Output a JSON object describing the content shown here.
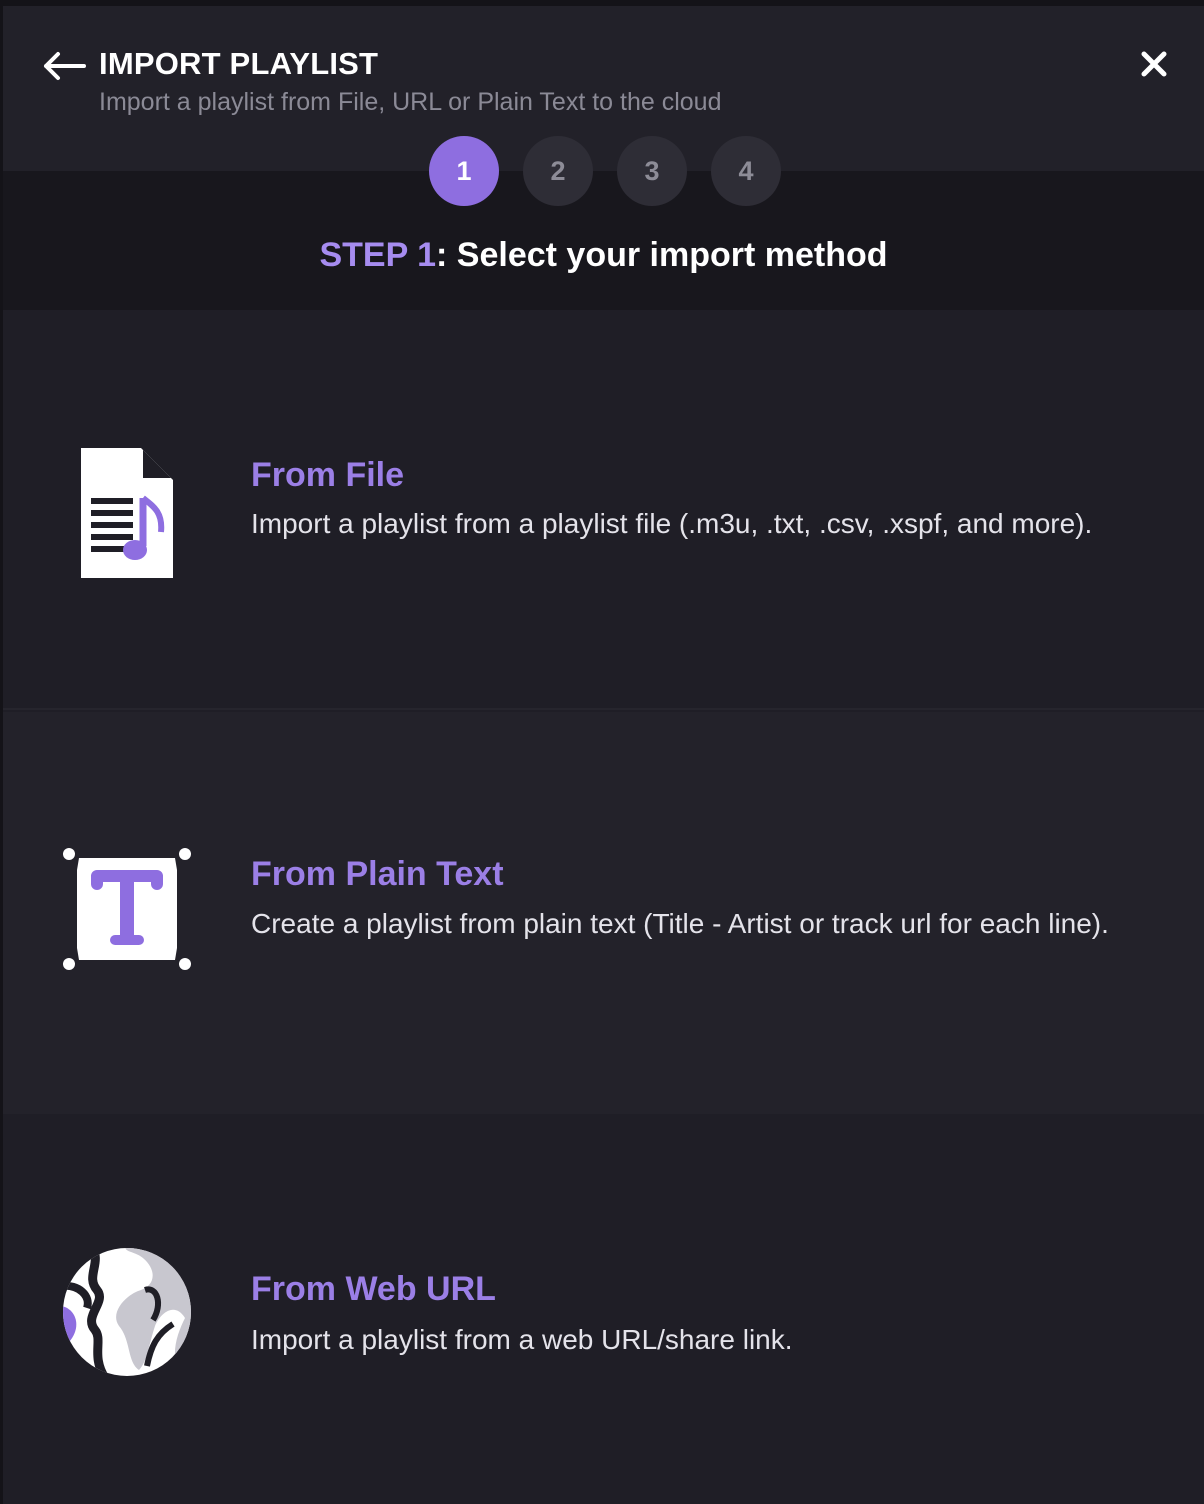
{
  "header": {
    "title": "IMPORT PLAYLIST",
    "subtitle": "Import a playlist from File, URL or Plain Text to the cloud",
    "back_icon": "arrow-left-icon",
    "close_icon": "close-icon"
  },
  "stepper": {
    "steps": [
      "1",
      "2",
      "3",
      "4"
    ],
    "active_step": 1
  },
  "step_heading": {
    "label": "STEP 1",
    "text": ": Select your import method"
  },
  "options": [
    {
      "icon": "music-file-icon",
      "title": "From File",
      "description": "Import a playlist from a playlist file (.m3u, .txt, .csv, .xspf, and more)."
    },
    {
      "icon": "text-frame-icon",
      "title": "From Plain Text",
      "description": "Create a playlist from plain text (Title - Artist or track url for each line)."
    },
    {
      "icon": "globe-icon",
      "title": "From Web URL",
      "description": "Import a playlist from a web URL/share link."
    }
  ],
  "colors": {
    "accent": "#8e6ee0",
    "accent_text": "#9b7fe6",
    "background": "#1f1e26"
  }
}
